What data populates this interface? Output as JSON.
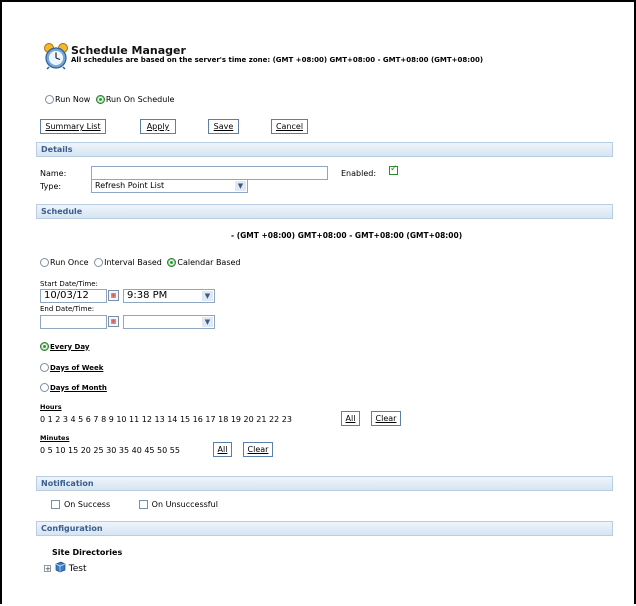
{
  "header": {
    "title": "Schedule Manager",
    "subtitle": "All schedules are based on the server's time zone: (GMT +08:00) GMT+08:00 - GMT+08:00 (GMT+08:00)"
  },
  "run_mode": {
    "options": [
      "Run Now",
      "Run On Schedule"
    ],
    "selected": "Run On Schedule"
  },
  "toolbar": {
    "summary_label": "Summary List",
    "apply_label": "Apply",
    "save_label": "Save",
    "cancel_label": "Cancel"
  },
  "details": {
    "section_title": "Details",
    "name_label": "Name:",
    "name_value": "",
    "enabled_label": "Enabled:",
    "enabled": true,
    "type_label": "Type:",
    "type_value": "Refresh Point List"
  },
  "schedule": {
    "section_title": "Schedule",
    "timezone": "- (GMT +08:00) GMT+08:00 - GMT+08:00 (GMT+08:00)",
    "modes": [
      "Run Once",
      "Interval Based",
      "Calendar Based"
    ],
    "selected_mode": "Calendar Based",
    "start_label": "Start Date/Time:",
    "start_date": "10/03/12",
    "start_time": "9:38 PM",
    "end_label": "End Date/Time:",
    "end_date": "",
    "end_time": "",
    "recurrence": [
      "Every Day",
      "Days of Week",
      "Days of Month"
    ],
    "selected_recurrence": "Every Day",
    "hours_label": "Hours",
    "hours_values": "0 1 2 3 4 5 6 7 8 9 10 11 12 13 14 15 16 17 18 19 20 21 22 23",
    "minutes_label": "Minutes",
    "minutes_values": "0 5 10 15 20 25 30 35 40 45 50 55",
    "all_label": "All",
    "clear_label": "Clear"
  },
  "notification": {
    "section_title": "Notification",
    "on_success_label": "On Success",
    "on_unsuccessful_label": "On Unsuccessful"
  },
  "configuration": {
    "section_title": "Configuration",
    "tree_title": "Site Directories",
    "tree_item": "Test"
  }
}
